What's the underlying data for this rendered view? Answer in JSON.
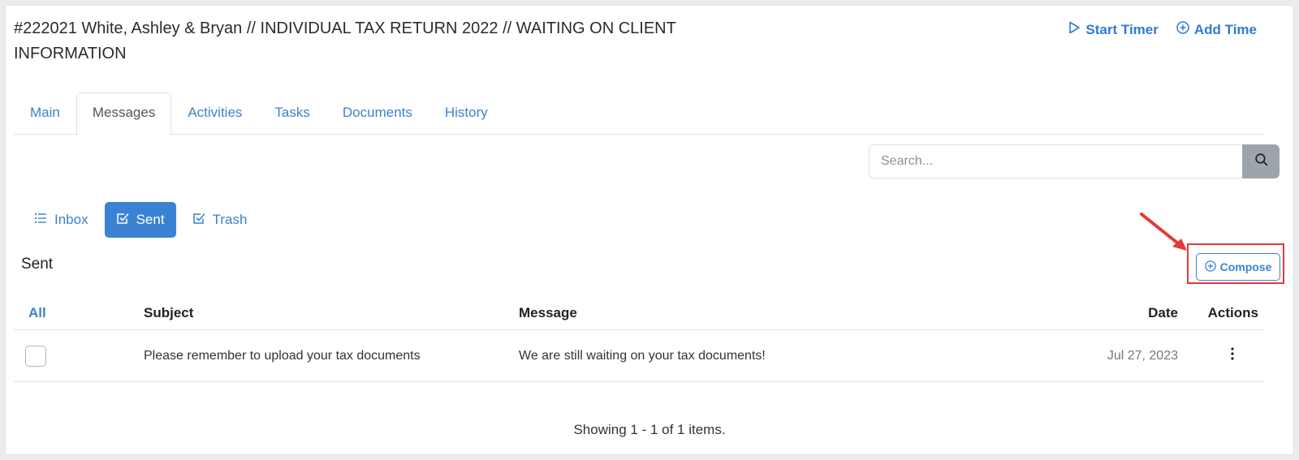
{
  "header": {
    "title": "#222021 White, Ashley & Bryan // INDIVIDUAL TAX RETURN 2022 // WAITING ON CLIENT INFORMATION",
    "start_timer": "Start Timer",
    "add_time": "Add Time"
  },
  "tabs": [
    {
      "label": "Main"
    },
    {
      "label": "Messages"
    },
    {
      "label": "Activities"
    },
    {
      "label": "Tasks"
    },
    {
      "label": "Documents"
    },
    {
      "label": "History"
    }
  ],
  "search": {
    "placeholder": "Search..."
  },
  "folders": {
    "inbox": "Inbox",
    "sent": "Sent",
    "trash": "Trash"
  },
  "section_title": "Sent",
  "compose_label": "Compose",
  "table": {
    "headers": {
      "all": "All",
      "subject": "Subject",
      "message": "Message",
      "date": "Date",
      "actions": "Actions"
    },
    "rows": [
      {
        "subject": "Please remember to upload your tax documents",
        "message": "We are still waiting on your tax documents!",
        "date": "Jul 27, 2023"
      }
    ]
  },
  "pagination": {
    "text": "Showing 1 - 1 of 1 items."
  },
  "colors": {
    "accent": "#3a83d2",
    "highlight": "#e53935"
  }
}
